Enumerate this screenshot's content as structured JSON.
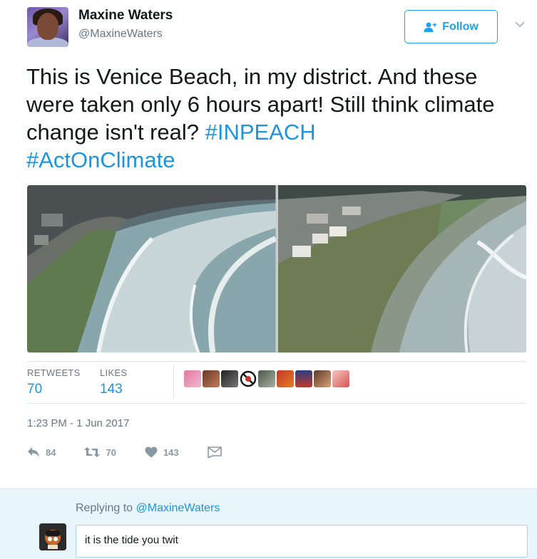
{
  "author": {
    "name": "Maxine Waters",
    "handle": "@MaxineWaters"
  },
  "follow_button": {
    "label": "Follow",
    "icon": "add-user-icon"
  },
  "caret_icon": "chevron-down-icon",
  "tweet": {
    "text_plain": "This is Venice Beach, in my district. And these were taken only 6 hours apart! Still think climate change isn't real? ",
    "hashtags": [
      "#INPEACH",
      "#ActOnClimate"
    ]
  },
  "media": {
    "photos": [
      {
        "description": "beach-high-tide"
      },
      {
        "description": "beach-low-tide"
      }
    ]
  },
  "stats": {
    "retweets_label": "RETWEETS",
    "retweets_value": "70",
    "likes_label": "LIKES",
    "likes_value": "143"
  },
  "timestamp": "1:23 PM - 1 Jun 2017",
  "actions": {
    "reply_count": "84",
    "retweet_count": "70",
    "like_count": "143",
    "reply_icon": "reply-icon",
    "retweet_icon": "retweet-icon",
    "like_icon": "heart-icon",
    "message_icon": "direct-message-icon"
  },
  "reply_composer": {
    "replying_prefix": "Replying to ",
    "replying_to": "@MaxineWaters",
    "value": "it is the tide you twit"
  },
  "colors": {
    "accent": "#1da1f2",
    "link": "#1b95e0",
    "muted": "#657786",
    "reply_bg": "#e8f5fd"
  }
}
